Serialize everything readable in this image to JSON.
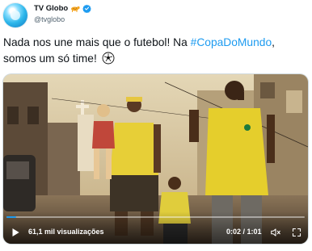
{
  "author": {
    "display_name": "TV Globo",
    "handle": "@tvglobo",
    "badge_icon": "jaguar-emoji-icon",
    "verified_icon": "verified-badge-icon"
  },
  "tweet": {
    "text_part1": "Nada nos une mais que o futebol! Na ",
    "hashtag": "#CopaDoMundo",
    "text_part2": ", somos um só time!",
    "emoji_icon": "soccer-ball-icon"
  },
  "video": {
    "views": "61,1 mil visualizações",
    "timecode": "0:02 / 1:01",
    "progress": 0.033,
    "play_icon": "play-icon",
    "volume_icon": "volume-muted-icon",
    "fullscreen_icon": "fullscreen-icon"
  },
  "colors": {
    "hashtag": "#1d9bf0",
    "verified": "#1d9bf0",
    "progress": "#1d9bf0"
  }
}
